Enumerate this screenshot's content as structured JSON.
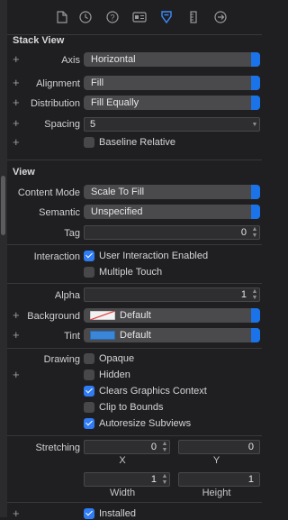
{
  "stack_view": {
    "title": "Stack View",
    "axis": {
      "label": "Axis",
      "value": "Horizontal"
    },
    "alignment": {
      "label": "Alignment",
      "value": "Fill"
    },
    "distribution": {
      "label": "Distribution",
      "value": "Fill Equally"
    },
    "spacing": {
      "label": "Spacing",
      "value": "5"
    },
    "baseline_relative": {
      "label": "Baseline Relative",
      "checked": false
    }
  },
  "view": {
    "title": "View",
    "content_mode": {
      "label": "Content Mode",
      "value": "Scale To Fill"
    },
    "semantic": {
      "label": "Semantic",
      "value": "Unspecified"
    },
    "tag": {
      "label": "Tag",
      "value": "0"
    },
    "interaction": {
      "label": "Interaction",
      "user_interaction": {
        "label": "User Interaction Enabled",
        "checked": true
      },
      "multiple_touch": {
        "label": "Multiple Touch",
        "checked": false
      }
    },
    "alpha": {
      "label": "Alpha",
      "value": "1"
    },
    "background": {
      "label": "Background",
      "value": "Default"
    },
    "tint": {
      "label": "Tint",
      "value": "Default",
      "color": "#3a86d8"
    },
    "drawing": {
      "label": "Drawing",
      "opaque": {
        "label": "Opaque",
        "checked": false
      },
      "hidden": {
        "label": "Hidden",
        "checked": false
      },
      "clears_graphics": {
        "label": "Clears Graphics Context",
        "checked": true
      },
      "clip_to_bounds": {
        "label": "Clip to Bounds",
        "checked": false
      },
      "autoresize": {
        "label": "Autoresize Subviews",
        "checked": true
      }
    },
    "stretching": {
      "label": "Stretching",
      "x": "0",
      "y": "0",
      "width": "1",
      "height": "1",
      "x_caption": "X",
      "y_caption": "Y",
      "width_caption": "Width",
      "height_caption": "Height"
    },
    "installed": {
      "label": "Installed",
      "checked": true
    }
  },
  "icons": [
    "file-icon",
    "history-icon",
    "help-icon",
    "identity-icon",
    "attributes-icon",
    "ruler-icon",
    "connections-icon"
  ],
  "colors": {
    "accent": "#2f7cf6",
    "active_tab": "#3b8cff",
    "panel": "#1f1f21"
  }
}
